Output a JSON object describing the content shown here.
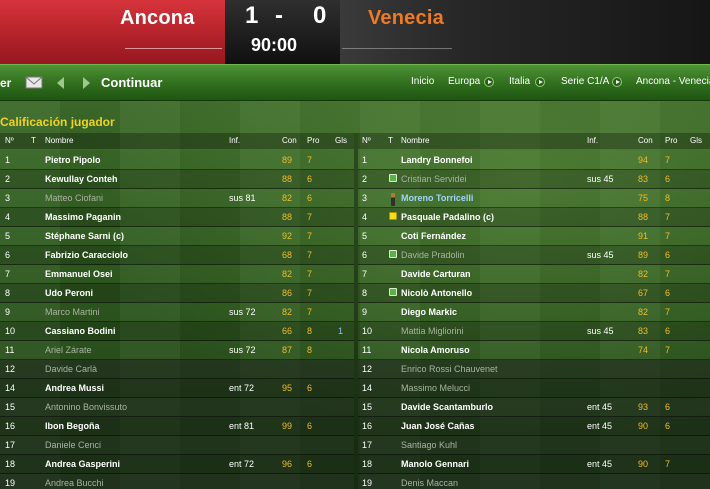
{
  "match": {
    "home_team": "Ancona",
    "away_team": "Venecia",
    "home_score": "1",
    "separator": "-",
    "away_score": "0",
    "clock": "90:00",
    "home_color": "#c4262e",
    "away_color": "#ee7b22"
  },
  "nav": {
    "left_cut_text": "er",
    "continue_label": "Continuar",
    "breadcrumbs": [
      "Inicio",
      "Europa",
      "Italia",
      "Serie C1/A",
      "Ancona - Venecia"
    ]
  },
  "section_title": "Calificación jugador",
  "columns": [
    "Nº",
    "T",
    "Nombre",
    "Inf.",
    "Con",
    "Pro",
    "Gls"
  ],
  "home_players": [
    {
      "num": "1",
      "icon": "",
      "name": "Pietro Pipolo",
      "inf": "",
      "con": "89",
      "pro": "7",
      "gls": "",
      "style": "normal"
    },
    {
      "num": "2",
      "icon": "",
      "name": "Kewullay Conteh",
      "inf": "",
      "con": "88",
      "pro": "6",
      "gls": "",
      "style": "normal"
    },
    {
      "num": "3",
      "icon": "",
      "name": "Matteo Ciofani",
      "inf": "sus 81",
      "con": "82",
      "pro": "6",
      "gls": "",
      "style": "faded"
    },
    {
      "num": "4",
      "icon": "",
      "name": "Massimo Paganin",
      "inf": "",
      "con": "88",
      "pro": "7",
      "gls": "",
      "style": "normal"
    },
    {
      "num": "5",
      "icon": "",
      "name": "Stéphane Sarni (c)",
      "inf": "",
      "con": "92",
      "pro": "7",
      "gls": "",
      "style": "normal"
    },
    {
      "num": "6",
      "icon": "",
      "name": "Fabrizio Caracciolo",
      "inf": "",
      "con": "68",
      "pro": "7",
      "gls": "",
      "style": "normal"
    },
    {
      "num": "7",
      "icon": "",
      "name": "Emmanuel Osei",
      "inf": "",
      "con": "82",
      "pro": "7",
      "gls": "",
      "style": "normal"
    },
    {
      "num": "8",
      "icon": "",
      "name": "Udo Peroni",
      "inf": "",
      "con": "86",
      "pro": "7",
      "gls": "",
      "style": "normal"
    },
    {
      "num": "9",
      "icon": "",
      "name": "Marco Martini",
      "inf": "sus 72",
      "con": "82",
      "pro": "7",
      "gls": "",
      "style": "faded"
    },
    {
      "num": "10",
      "icon": "",
      "name": "Cassiano Bodini",
      "inf": "",
      "con": "66",
      "pro": "8",
      "gls": "1",
      "style": "normal"
    },
    {
      "num": "11",
      "icon": "",
      "name": "Ariel Zárate",
      "inf": "sus 72",
      "con": "87",
      "pro": "8",
      "gls": "",
      "style": "faded"
    },
    {
      "num": "12",
      "icon": "",
      "name": "Davide Carlà",
      "inf": "",
      "con": "",
      "pro": "",
      "gls": "",
      "style": "faded"
    },
    {
      "num": "14",
      "icon": "",
      "name": "Andrea Mussi",
      "inf": "ent 72",
      "con": "95",
      "pro": "6",
      "gls": "",
      "style": "normal"
    },
    {
      "num": "15",
      "icon": "",
      "name": "Antonino Bonvissuto",
      "inf": "",
      "con": "",
      "pro": "",
      "gls": "",
      "style": "faded"
    },
    {
      "num": "16",
      "icon": "",
      "name": "Ibon Begoña",
      "inf": "ent 81",
      "con": "99",
      "pro": "6",
      "gls": "",
      "style": "normal"
    },
    {
      "num": "17",
      "icon": "",
      "name": "Daniele Cenci",
      "inf": "",
      "con": "",
      "pro": "",
      "gls": "",
      "style": "faded"
    },
    {
      "num": "18",
      "icon": "",
      "name": "Andrea Gasperini",
      "inf": "ent 72",
      "con": "96",
      "pro": "6",
      "gls": "",
      "style": "normal"
    },
    {
      "num": "19",
      "icon": "",
      "name": "Andrea Bucchi",
      "inf": "",
      "con": "",
      "pro": "",
      "gls": "",
      "style": "faded"
    }
  ],
  "away_players": [
    {
      "num": "1",
      "icon": "",
      "name": "Landry Bonnefoi",
      "inf": "",
      "con": "94",
      "pro": "7",
      "gls": "",
      "style": "normal"
    },
    {
      "num": "2",
      "icon": "sub",
      "name": "Cristian Servidei",
      "inf": "sus 45",
      "con": "83",
      "pro": "6",
      "gls": "",
      "style": "faded"
    },
    {
      "num": "3",
      "icon": "person",
      "name": "Moreno Torricelli",
      "inf": "",
      "con": "75",
      "pro": "8",
      "gls": "",
      "style": "blue"
    },
    {
      "num": "4",
      "icon": "yellow",
      "name": "Pasquale Padalino (c)",
      "inf": "",
      "con": "88",
      "pro": "7",
      "gls": "",
      "style": "normal"
    },
    {
      "num": "5",
      "icon": "",
      "name": "Coti Fernández",
      "inf": "",
      "con": "91",
      "pro": "7",
      "gls": "",
      "style": "normal"
    },
    {
      "num": "6",
      "icon": "sub",
      "name": "Davide Pradolin",
      "inf": "sus 45",
      "con": "89",
      "pro": "6",
      "gls": "",
      "style": "faded"
    },
    {
      "num": "7",
      "icon": "",
      "name": "Davide Carturan",
      "inf": "",
      "con": "82",
      "pro": "7",
      "gls": "",
      "style": "normal"
    },
    {
      "num": "8",
      "icon": "sub",
      "name": "Nicolò Antonello",
      "inf": "",
      "con": "67",
      "pro": "6",
      "gls": "",
      "style": "normal"
    },
    {
      "num": "9",
      "icon": "",
      "name": "Diego Markic",
      "inf": "",
      "con": "82",
      "pro": "7",
      "gls": "",
      "style": "normal"
    },
    {
      "num": "10",
      "icon": "",
      "name": "Mattia Migliorini",
      "inf": "sus 45",
      "con": "83",
      "pro": "6",
      "gls": "",
      "style": "faded"
    },
    {
      "num": "11",
      "icon": "",
      "name": "Nicola Amoruso",
      "inf": "",
      "con": "74",
      "pro": "7",
      "gls": "",
      "style": "normal"
    },
    {
      "num": "12",
      "icon": "",
      "name": "Enrico Rossi Chauvenet",
      "inf": "",
      "con": "",
      "pro": "",
      "gls": "",
      "style": "faded"
    },
    {
      "num": "14",
      "icon": "",
      "name": "Massimo Melucci",
      "inf": "",
      "con": "",
      "pro": "",
      "gls": "",
      "style": "faded"
    },
    {
      "num": "15",
      "icon": "",
      "name": "Davide Scantamburlo",
      "inf": "ent 45",
      "con": "93",
      "pro": "6",
      "gls": "",
      "style": "normal"
    },
    {
      "num": "16",
      "icon": "",
      "name": "Juan José Cañas",
      "inf": "ent 45",
      "con": "90",
      "pro": "6",
      "gls": "",
      "style": "normal"
    },
    {
      "num": "17",
      "icon": "",
      "name": "Santiago Kuhl",
      "inf": "",
      "con": "",
      "pro": "",
      "gls": "",
      "style": "faded"
    },
    {
      "num": "18",
      "icon": "",
      "name": "Manolo Gennari",
      "inf": "ent 45",
      "con": "90",
      "pro": "7",
      "gls": "",
      "style": "normal"
    },
    {
      "num": "19",
      "icon": "",
      "name": "Denis Maccan",
      "inf": "",
      "con": "",
      "pro": "",
      "gls": "",
      "style": "faded"
    }
  ]
}
